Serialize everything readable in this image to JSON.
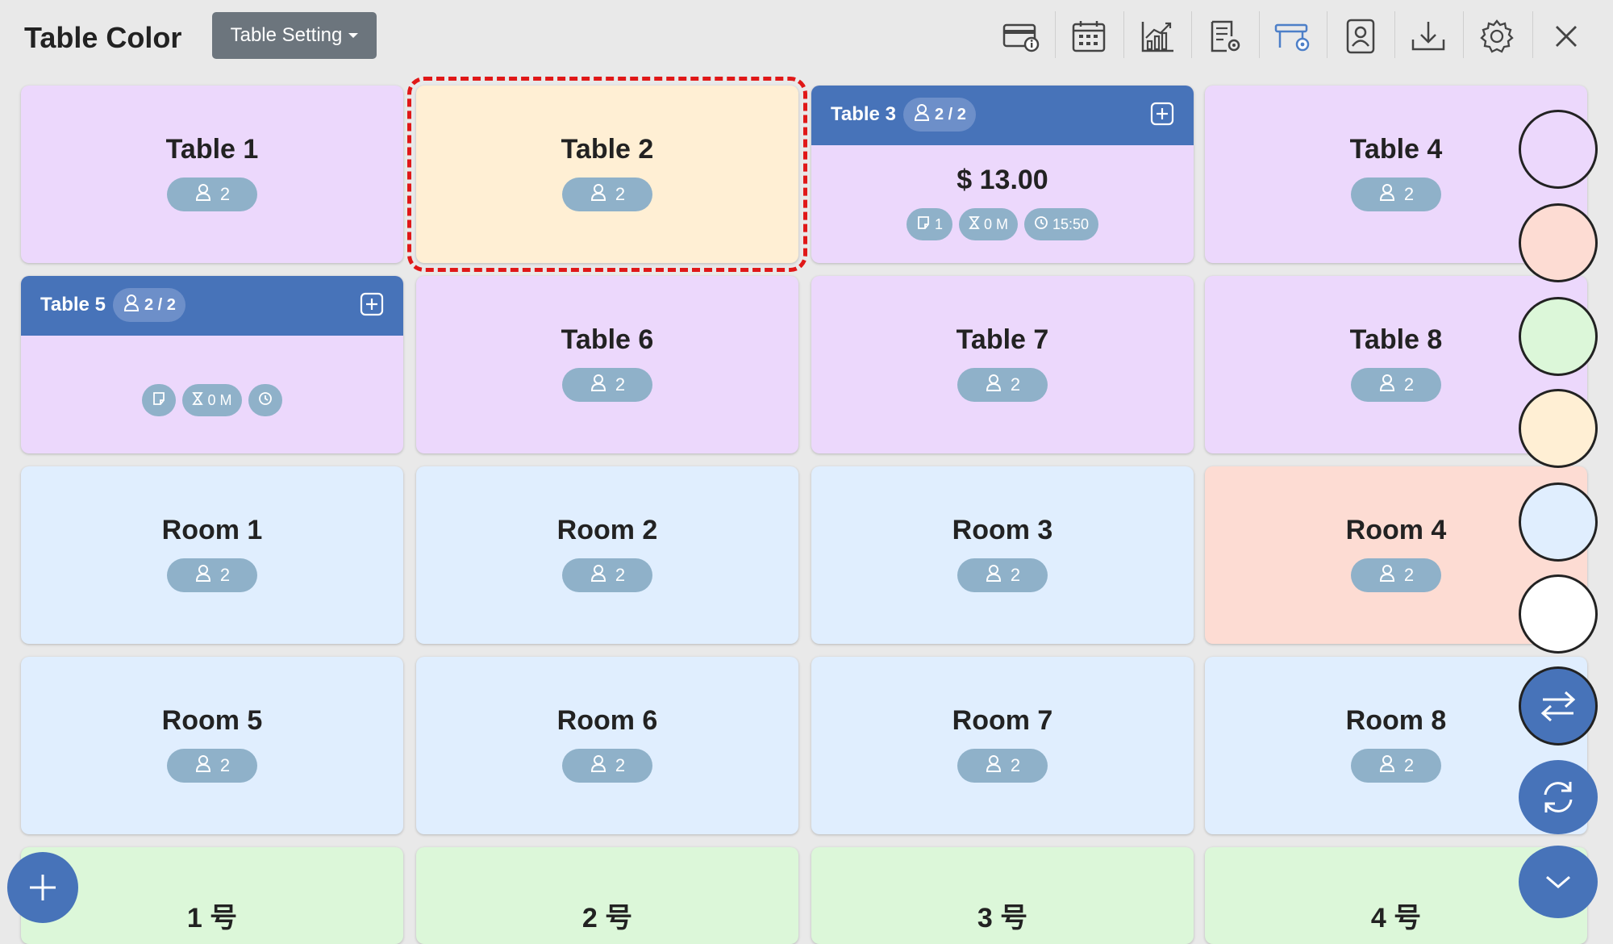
{
  "header": {
    "title": "Table Color",
    "setting_label": "Table Setting",
    "tools": [
      "card-info-icon",
      "calendar-icon",
      "chart-icon",
      "report-settings-icon",
      "table-settings-icon",
      "user-badge-icon",
      "download-icon",
      "gear-icon",
      "close-icon"
    ]
  },
  "tables": [
    {
      "name": "Table 1",
      "guests": "2",
      "color": "#ecd8fc"
    },
    {
      "name": "Table 2",
      "guests": "2",
      "color": "#ffefd4",
      "selected": true
    },
    {
      "name": "Table 3",
      "occupancy": "2 / 2",
      "amount": "$ 13.00",
      "notes": "1",
      "duration": "0 M",
      "time": "15:50",
      "color": "#ecd8fc",
      "occupied": true
    },
    {
      "name": "Table 4",
      "guests": "2",
      "color": "#ecd8fc"
    },
    {
      "name": "Table 5",
      "occupancy": "2 / 2",
      "duration": "0 M",
      "color": "#ecd8fc",
      "occupied": true
    },
    {
      "name": "Table 6",
      "guests": "2",
      "color": "#ecd8fc"
    },
    {
      "name": "Table 7",
      "guests": "2",
      "color": "#ecd8fc"
    },
    {
      "name": "Table 8",
      "guests": "2",
      "color": "#ecd8fc"
    }
  ],
  "rooms": [
    {
      "name": "Room 1",
      "guests": "2",
      "color": "#e0eefe"
    },
    {
      "name": "Room 2",
      "guests": "2",
      "color": "#e0eefe"
    },
    {
      "name": "Room 3",
      "guests": "2",
      "color": "#e0eefe"
    },
    {
      "name": "Room 4",
      "guests": "2",
      "color": "#fddcd3"
    },
    {
      "name": "Room 5",
      "guests": "2",
      "color": "#e0eefe"
    },
    {
      "name": "Room 6",
      "guests": "2",
      "color": "#e0eefe"
    },
    {
      "name": "Room 7",
      "guests": "2",
      "color": "#e0eefe"
    },
    {
      "name": "Room 8",
      "guests": "2",
      "color": "#e0eefe"
    }
  ],
  "numbered": [
    {
      "name": "1 号",
      "color": "#dcf7d9"
    },
    {
      "name": "2 号",
      "color": "#dcf7d9"
    },
    {
      "name": "3 号",
      "color": "#dcf7d9"
    },
    {
      "name": "4 号",
      "color": "#dcf7d9"
    }
  ],
  "palette": [
    "#ecd8fc",
    "#fddcd3",
    "#dcf7d9",
    "#ffefd4",
    "#e0eefe",
    "#ffffff"
  ],
  "fabs": [
    "swap-icon",
    "refresh-icon",
    "chevron-down-icon",
    "add-icon"
  ]
}
